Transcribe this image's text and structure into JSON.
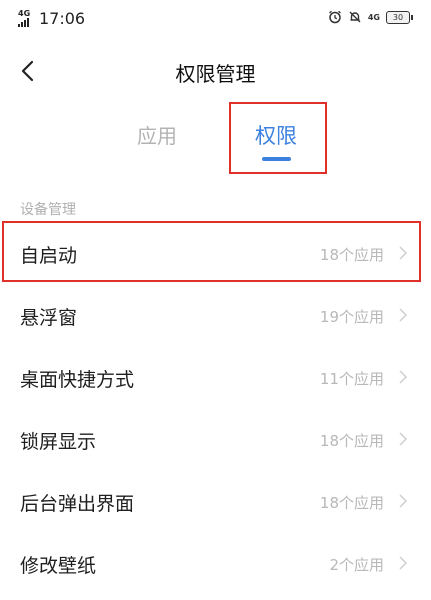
{
  "status_bar": {
    "network": "4G",
    "time": "17:06",
    "network_right": "4G",
    "battery": "30",
    "icons": [
      "alarm-icon",
      "do-not-disturb-icon",
      "signal-icon",
      "battery-icon"
    ]
  },
  "header": {
    "title": "权限管理",
    "back_icon": "chevron-left-icon"
  },
  "tabs": [
    {
      "label": "应用",
      "selected": false
    },
    {
      "label": "权限",
      "selected": true
    }
  ],
  "section": {
    "title": "设备管理"
  },
  "items": [
    {
      "label": "自启动",
      "count": "18个应用"
    },
    {
      "label": "悬浮窗",
      "count": "19个应用"
    },
    {
      "label": "桌面快捷方式",
      "count": "11个应用"
    },
    {
      "label": "锁屏显示",
      "count": "18个应用"
    },
    {
      "label": "后台弹出界面",
      "count": "18个应用"
    },
    {
      "label": "修改壁纸",
      "count": "2个应用"
    }
  ],
  "colors": {
    "accent": "#3b82e0",
    "highlight_box": "#e0302a",
    "muted_text": "#b8b8b8"
  }
}
